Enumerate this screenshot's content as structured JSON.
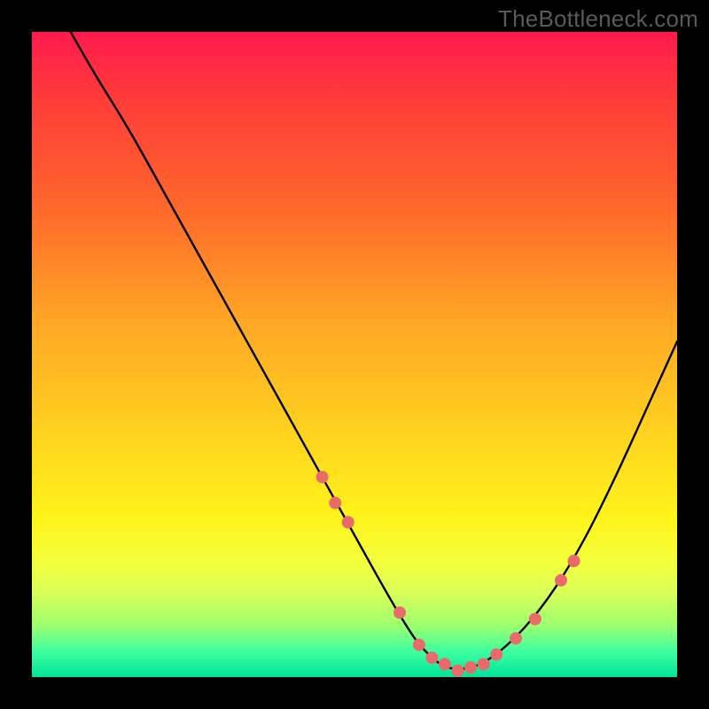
{
  "attribution": "TheBottleneck.com",
  "chart_data": {
    "type": "line",
    "title": "",
    "xlabel": "",
    "ylabel": "",
    "xlim": [
      0,
      100
    ],
    "ylim": [
      0,
      100
    ],
    "series": [
      {
        "name": "bottleneck-curve",
        "x": [
          6,
          10,
          15,
          20,
          25,
          30,
          35,
          40,
          45,
          50,
          55,
          58,
          60,
          63,
          66,
          70,
          75,
          80,
          85,
          90,
          95,
          100
        ],
        "y": [
          100,
          93,
          85,
          76,
          67,
          58,
          49,
          40,
          31,
          22,
          13,
          8,
          5,
          2,
          1,
          2,
          6,
          12,
          20,
          30,
          41,
          52
        ]
      }
    ],
    "markers": {
      "name": "highlighted-points",
      "color": "#e86a6a",
      "x": [
        45,
        47,
        49,
        57,
        60,
        62,
        64,
        66,
        68,
        70,
        72,
        75,
        78,
        82,
        84
      ],
      "y": [
        31,
        27,
        24,
        10,
        5,
        3,
        2,
        1,
        1.5,
        2,
        3.5,
        6,
        9,
        15,
        18
      ]
    }
  }
}
